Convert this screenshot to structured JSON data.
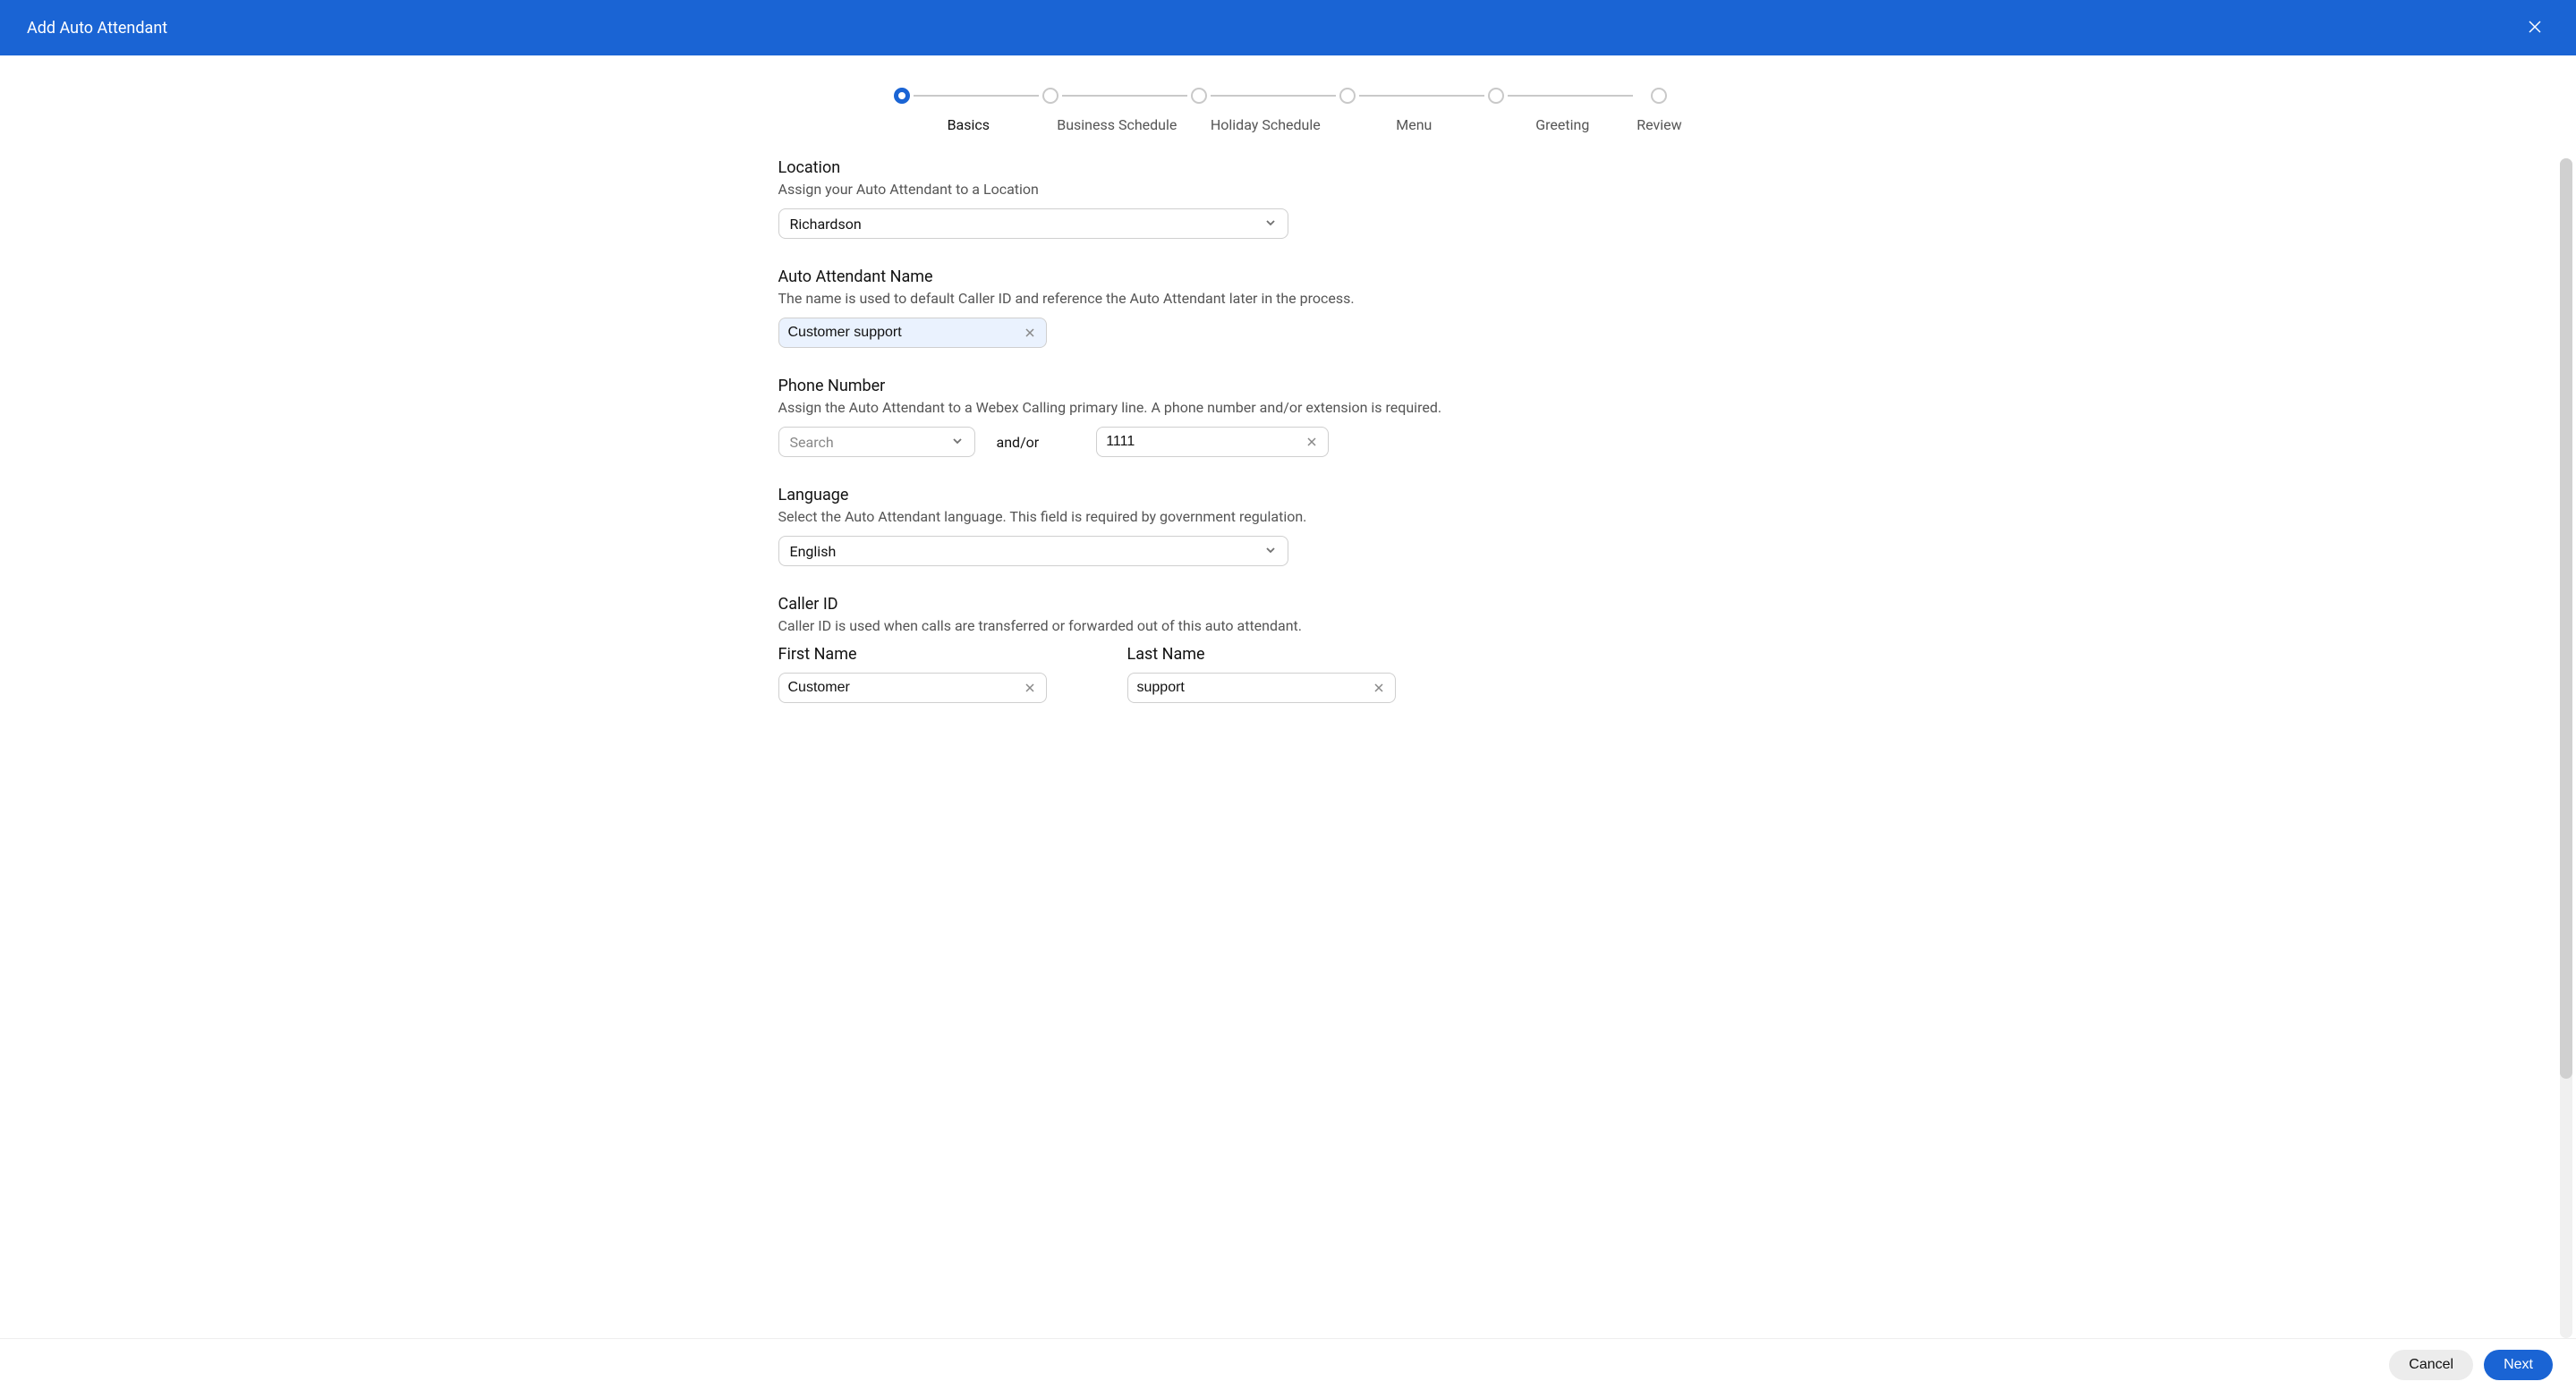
{
  "header": {
    "title": "Add Auto Attendant"
  },
  "stepper": [
    {
      "label": "Basics",
      "active": true
    },
    {
      "label": "Business Schedule",
      "active": false
    },
    {
      "label": "Holiday Schedule",
      "active": false
    },
    {
      "label": "Menu",
      "active": false
    },
    {
      "label": "Greeting",
      "active": false
    },
    {
      "label": "Review",
      "active": false
    }
  ],
  "location": {
    "title": "Location",
    "desc": "Assign your Auto Attendant to a Location",
    "value": "Richardson"
  },
  "name": {
    "title": "Auto Attendant Name",
    "desc": "The name is used to default Caller ID and reference the Auto Attendant later in the process.",
    "value": "Customer support"
  },
  "phone": {
    "title": "Phone Number",
    "desc": "Assign the Auto Attendant to a Webex Calling primary line. A phone number and/or extension is required.",
    "search_placeholder": "Search",
    "andor": "and/or",
    "extension_value": "1111"
  },
  "language": {
    "title": "Language",
    "desc": "Select the Auto Attendant language. This field is required by government regulation.",
    "value": "English"
  },
  "callerid": {
    "title": "Caller ID",
    "desc": "Caller ID is used when calls are transferred or forwarded out of this auto attendant.",
    "first_label": "First Name",
    "first_value": "Customer",
    "last_label": "Last Name",
    "last_value": "support"
  },
  "footer": {
    "cancel": "Cancel",
    "next": "Next"
  }
}
